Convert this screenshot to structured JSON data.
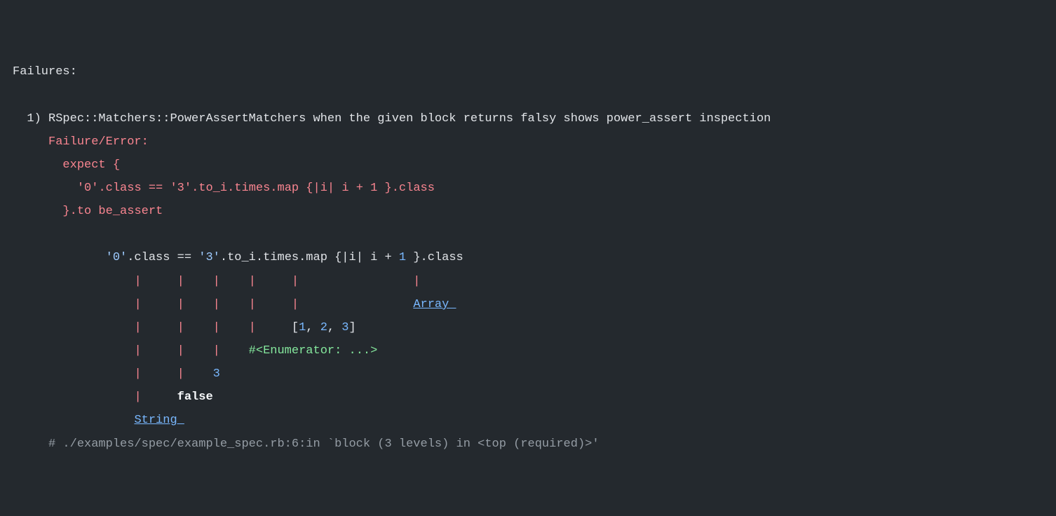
{
  "header": "Failures:",
  "item": {
    "num": "  1) ",
    "desc": "RSpec::Matchers::PowerAssertMatchers when the given block returns falsy shows power_assert inspection",
    "fail_label": "Failure/Error:",
    "code": {
      "expect": "expect {",
      "l_str0": "'0'",
      "l_class": ".class ",
      "op": "==",
      "r_str3": " '3'",
      "r_chain": ".to_i.times.map {|i| i + ",
      "one": "1",
      "r_tail": " }.class",
      "close": "}.to be_assert"
    },
    "assert": {
      "expr_pre": "'0'",
      "expr_mid1": ".class ",
      "expr_op": "==",
      "expr_s3": " '3'",
      "expr_chain": ".to_i.times.map {|i| i + ",
      "expr_one": "1",
      "expr_tail": " }.class",
      "row_pipes1": "|     |    |    |     |                |",
      "row_pipes2a": "|     |    |    |     |                ",
      "array_label": "Array ",
      "row_pipes3a": "|     |    |    |     ",
      "arr_open": "[",
      "arr_1": "1",
      "arr_c1": ", ",
      "arr_2": "2",
      "arr_c2": ", ",
      "arr_3": "3",
      "arr_close": "]",
      "row_pipes4a": "|     |    |    ",
      "enum": "#<Enumerator: ...>",
      "row_pipes5a": "|     |    ",
      "three": "3",
      "row_pipes6a": "|     ",
      "false": "false",
      "string_label": "String "
    },
    "trace": "# ./examples/spec/example_spec.rb:6:in `block (3 levels) in <top (required)>'"
  }
}
